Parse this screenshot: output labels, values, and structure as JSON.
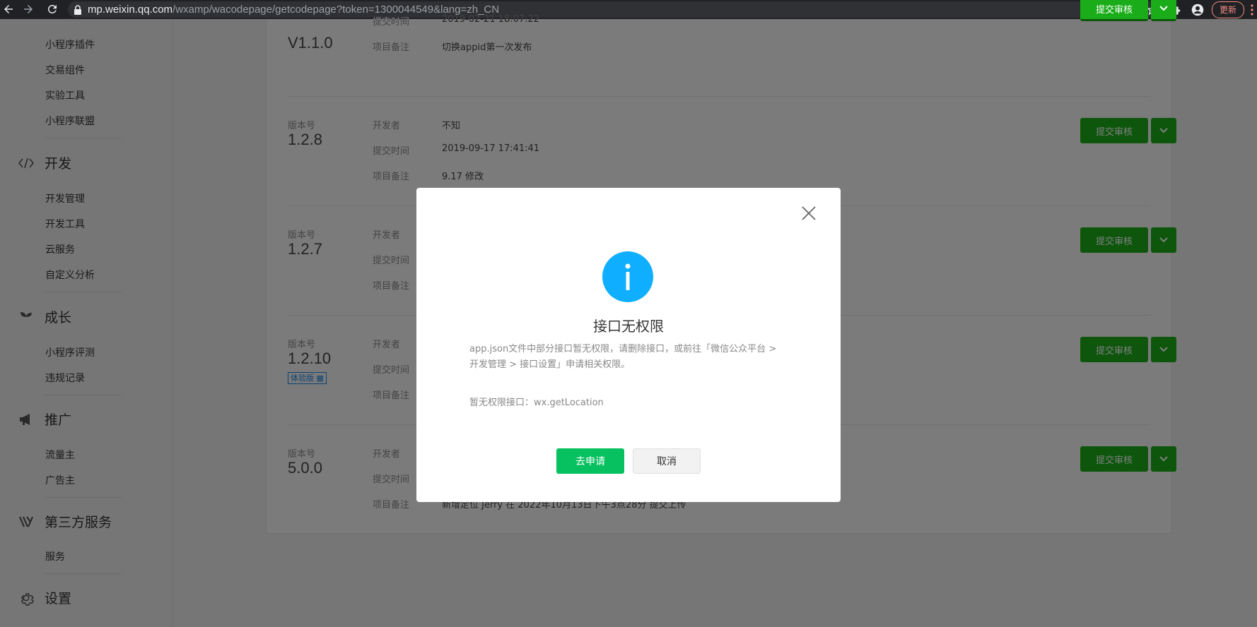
{
  "browser": {
    "url_host": "mp.weixin.qq.com",
    "url_path": "/wxamp/wacodepage/getcodepage?token=1300044549&lang=zh_CN",
    "update_label": "更新"
  },
  "sidebar": {
    "items_top": [
      "小程序插件",
      "交易组件",
      "实验工具",
      "小程序联盟"
    ],
    "sections": [
      {
        "label": "开发",
        "icon": "code-icon",
        "items": [
          "开发管理",
          "开发工具",
          "云服务",
          "自定义分析"
        ]
      },
      {
        "label": "成长",
        "icon": "sprout-icon",
        "items": [
          "小程序评测",
          "违规记录"
        ]
      },
      {
        "label": "推广",
        "icon": "megaphone-icon",
        "items": [
          "流量主",
          "广告主"
        ]
      },
      {
        "label": "第三方服务",
        "icon": "third-party-icon",
        "items": [
          "服务"
        ]
      },
      {
        "label": "设置",
        "icon": "gear-icon",
        "items": []
      }
    ]
  },
  "labels": {
    "version": "版本号",
    "developer": "开发者",
    "submit_time": "提交时间",
    "remark": "项目备注",
    "submit_button": "提交审核"
  },
  "versions": [
    {
      "number": "V1.1.0",
      "developer": "",
      "time": "2019-02-21 18:07:22",
      "remark": "切换appid第一次发布"
    },
    {
      "number": "1.2.8",
      "developer": "不知",
      "time": "2019-09-17 17:41:41",
      "remark": "9.17 修改"
    },
    {
      "number": "1.2.7",
      "developer": "",
      "time": "",
      "remark": ""
    },
    {
      "number": "1.2.10",
      "badge": "体验版",
      "developer": "",
      "time": "",
      "remark": ""
    },
    {
      "number": "5.0.0",
      "developer": "",
      "time": "",
      "remark": "新增定位 Jerry 在 2022年10月13日下午3点28分 提交上传"
    }
  ],
  "modal": {
    "title": "接口无权限",
    "description": "app.json文件中部分接口暂无权限，请删除接口，或前往「微信公众平台 > 开发管理 > 接口设置」申请相关权限。",
    "api_line": "暂无权限接口：wx.getLocation",
    "confirm_label": "去申请",
    "cancel_label": "取消"
  },
  "colors": {
    "primary_green": "#1aad19",
    "confirm_green": "#07c160",
    "info_blue": "#10aeff"
  }
}
